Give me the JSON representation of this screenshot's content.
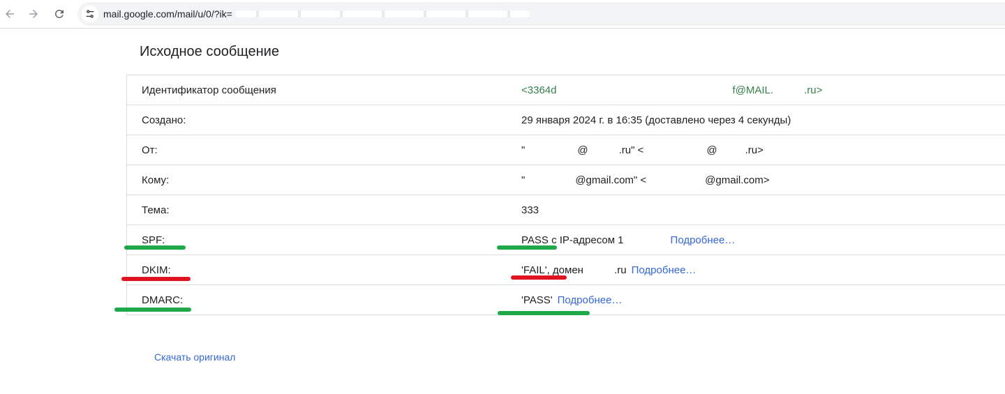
{
  "browser": {
    "url_visible": "mail.google.com/mail/u/0/?ik="
  },
  "page": {
    "title": "Исходное сообщение",
    "download_label": "Скачать оригинал"
  },
  "rows": [
    {
      "label": "Идентификатор сообщения",
      "value": "<3364d",
      "value_tail": "f@MAIL.",
      "value_end": ".ru>"
    },
    {
      "label": "Создано:",
      "value": "29 января 2024 г. в 16:35 (доставлено через 4 секунды)"
    },
    {
      "label": "От:",
      "value": "\"",
      "value_mid": "@",
      "value_mid2": ".ru\" <",
      "value_mid3": "@",
      "value_end": ".ru>"
    },
    {
      "label": "Кому:",
      "value": "\"",
      "value_mid": "@gmail.com\" <",
      "value_end": "@gmail.com>"
    },
    {
      "label": "Тема:",
      "value": "333"
    },
    {
      "label": "SPF:",
      "value": "PASS с IP-адресом 1",
      "link": "Подробнее…"
    },
    {
      "label": "DKIM:",
      "value": "'FAIL', домен ",
      "value_end": ".ru",
      "link": "Подробнее…"
    },
    {
      "label": "DMARC:",
      "value": "'PASS'",
      "link": "Подробнее…"
    }
  ],
  "colors": {
    "marker_green": "#1fa84a",
    "marker_red": "#e0141e",
    "link": "#3367d6",
    "message_id": "#34804a"
  },
  "icons": {
    "back": "arrow-left-icon",
    "forward": "arrow-right-icon",
    "reload": "reload-icon",
    "site_info": "tune-icon"
  }
}
